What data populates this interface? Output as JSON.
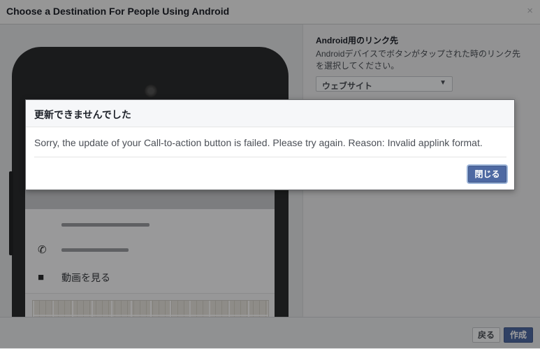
{
  "dialog": {
    "title": "Choose a Destination For People Using Android",
    "close_glyph": "×"
  },
  "right_panel": {
    "heading": "Android用のリンク先",
    "description": "Androidデバイスでボタンがタップされた時のリンク先を選択してください。",
    "dropdown_value": "ウェブサイト",
    "dropdown_arrow": "▼"
  },
  "phone_preview": {
    "wifi_glyph": "◠",
    "signal_glyph": "◢",
    "phone_icon": "✆",
    "video_icon": "■",
    "video_label": "動画を見る"
  },
  "footer": {
    "back_label": "戻る",
    "create_label": "作成"
  },
  "error_modal": {
    "title": "更新できませんでした",
    "message": "Sorry, the update of your Call-to-action button is failed. Please try again. Reason: Invalid applink format.",
    "close_label": "閉じる"
  },
  "colors": {
    "primary_button": "#4e69a2",
    "overlay": "rgba(0,0,0,0.38)"
  }
}
